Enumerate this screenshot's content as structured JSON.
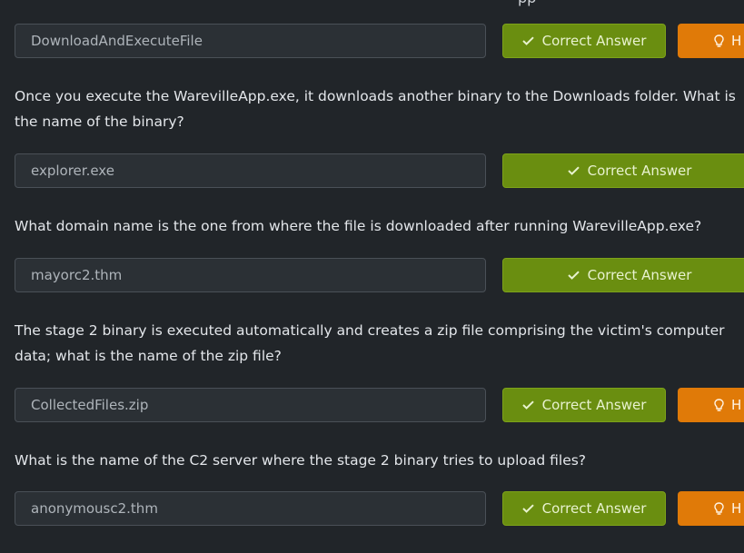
{
  "top_fragment": "pp",
  "items": [
    {
      "question": "",
      "answer": "DownloadAndExecuteFile",
      "correct_label": "Correct Answer",
      "hint_label": "H"
    },
    {
      "question": "Once you execute the WarevilleApp.exe, it downloads another binary to the Downloads folder. What is the name of the binary?",
      "answer": "explorer.exe",
      "correct_label": "Correct Answer"
    },
    {
      "question": "What domain name is the one from where the file is downloaded after running WarevilleApp.exe?",
      "answer": "mayorc2.thm",
      "correct_label": "Correct Answer"
    },
    {
      "question": "The stage 2 binary is executed automatically and creates a zip file comprising the victim's computer data; what is the name of the zip file?",
      "answer": "CollectedFiles.zip",
      "correct_label": "Correct Answer",
      "hint_label": "H"
    },
    {
      "question": "What is the name of the C2 server where the stage 2 binary tries to upload files?",
      "answer": "anonymousc2.thm",
      "correct_label": "Correct Answer",
      "hint_label": "H"
    }
  ],
  "colors": {
    "background": "#212529",
    "correct_green": "#6a8e10",
    "hint_orange": "#e07a08"
  },
  "icons": [
    "check-icon",
    "lightbulb-icon"
  ]
}
